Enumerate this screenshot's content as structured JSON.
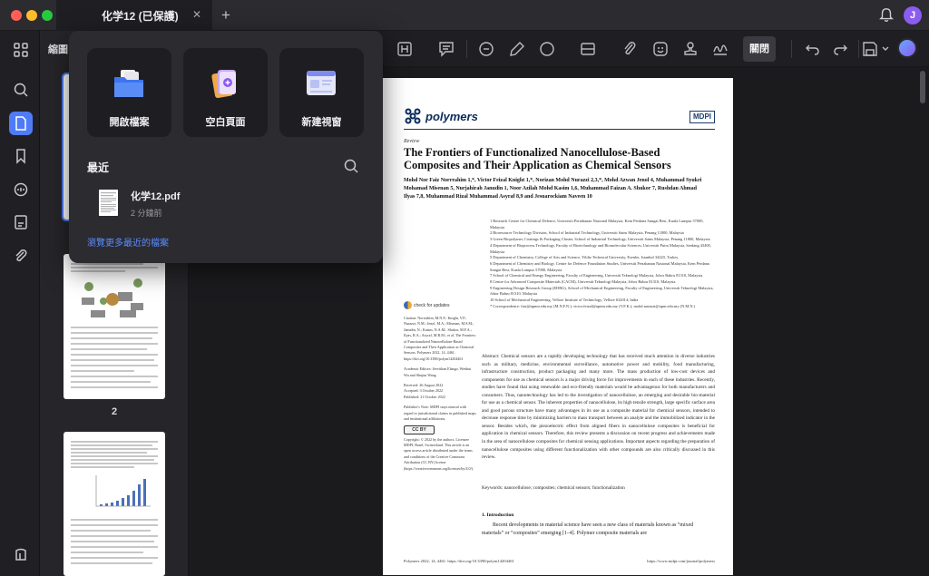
{
  "window": {
    "tab_title": "化学12 (已保護)",
    "tab_close": "✕",
    "tab_add": "+",
    "avatar_letter": "J"
  },
  "colors": {
    "accent": "#4f7bf7",
    "link": "#5b8cff",
    "avatar": "#8c5cf0",
    "close_dot": "#fe5f57",
    "min_dot": "#febc2e",
    "max_dot": "#28c840"
  },
  "sidebar": {
    "title": "縮圖",
    "rail_icons": [
      "grid-icon",
      "search-icon",
      "page-icon",
      "bookmark-icon",
      "comment-icon",
      "form-icon",
      "attachment-icon",
      "layers-icon"
    ],
    "pages": [
      "2"
    ]
  },
  "toolbar": {
    "close_mode_label": "關閉",
    "tools": [
      "textbox-icon",
      "note-icon",
      "comment-icon",
      "highlighter-icon",
      "shape-icon",
      "measure-icon",
      "attachment-icon",
      "sticker-icon",
      "stamp-icon",
      "signature-icon",
      "undo-icon",
      "redo-icon",
      "save-icon",
      "ai-assistant-icon"
    ]
  },
  "popup": {
    "actions": [
      {
        "label": "開啟檔案",
        "icon": "folder-icon"
      },
      {
        "label": "空白頁面",
        "icon": "blank-page-icon"
      },
      {
        "label": "新建視窗",
        "icon": "new-window-icon"
      }
    ],
    "recent_title": "最近",
    "recent_files": [
      {
        "name": "化学12.pdf",
        "time": "2 分鐘前"
      }
    ],
    "browse_more": "瀏覽更多最近的檔案"
  },
  "document": {
    "journal": "polymers",
    "publisher": "MDPI",
    "article_type": "Review",
    "title": "The Frontiers of Functionalized Nanocellulose-Based Composites and Their Application as Chemical Sensors",
    "authors": "Mohd Nor Faiz Norrrahim 1,*, Victor Feizal Knight 1,*, Norizan Mohd Nurazzi 2,3,*, Mohd Azwan Jenol 4, Muhammad Syukri Mohamad Misenan 5, Nurjahirah Janudin 1, Noor Azilah Mohd Kasim 1,6, Muhammad Faizan A. Shukor 7, Rushdan Ahmad Ilyas 7,8, Muhammad Rizal Muhammad Asyraf 8,9 and Jesuarockiam Naveen 10",
    "affiliations": [
      "1  Research Centre for Chemical Defence, Universiti Pertahanan Nasional Malaysia, Kem Perdana Sungai Besi, Kuala Lumpur 57000, Malaysia",
      "2  Bioresource Technology Division, School of Industrial Technology, Universiti Sains Malaysia, Penang 11800, Malaysia",
      "3  Green Biopolymer, Coatings & Packaging Cluster, School of Industrial Technology, Universiti Sains Malaysia, Penang 11800, Malaysia",
      "4  Department of Bioprocess Technology, Faculty of Biotechnology and Biomolecular Sciences, Universiti Putra Malaysia, Serdang 43400, Malaysia",
      "5  Department of Chemistry, College of Arts and Science, Yildiz Technical University, Esenler, Istanbul 34220, Turkey",
      "6  Department of Chemistry and Biology, Centre for Defence Foundation Studies, Universiti Pertahanan Nasional Malaysia, Kem Perdana Sungai Besi, Kuala Lumpur 57000, Malaysia",
      "7  School of Chemical and Energy Engineering, Faculty of Engineering, Universiti Teknologi Malaysia, Johor Bahru 81310, Malaysia",
      "8  Centre for Advanced Composite Materials (CACM), Universiti Teknologi Malaysia, Johor Bahru 81310, Malaysia",
      "9  Engineering Design Research Group (EDRG), School of Mechanical Engineering, Faculty of Engineering, Universiti Teknologi Malaysia, Johor Bahru 81310, Malaysia",
      "10 School of Mechanical Engineering, Vellore Institute of Technology, Vellore 632014, India",
      "*  Correspondence: faiz@upnm.edu.my (M.N.F.N.); victor.feizal@upnm.edu.my (V.F.K.); mohd.nurazzi@upm.edu.my (N.M.N.)"
    ],
    "check_updates": "check for updates",
    "citation": "Citation: Norrrahim, M.N.F.; Knight, V.F.; Nurazzi, N.M.; Jenol, M.A.; Misenan, M.S.M.; Janudin, N.; Kasim, N.A.M.; Shukor, M.F.A.; Ilyas, R.A.; Asyraf, M.R.M.; et al. The Frontiers of Functionalized Nanocellulose-Based Composites and Their Application as Chemical Sensors. Polymers 2022, 14, 4461. https://doi.org/10.3390/polym14204461",
    "editors": "Academic Editors: Jeevithan Elango, Wenhui Wu and Shujun Wang",
    "received": "Received: 26 August 2022",
    "accepted": "Accepted: 3 October 2022",
    "published": "Published: 21 October 2022",
    "publisher_note": "Publisher's Note: MDPI stays neutral with regard to jurisdictional claims in published maps and institutional affiliations.",
    "cc_badge": "CC BY",
    "copyright": "Copyright: © 2022 by the authors. Licensee MDPI, Basel, Switzerland. This article is an open access article distributed under the terms and conditions of the Creative Commons Attribution (CC BY) license (https://creativecommons.org/licenses/by/4.0/).",
    "abstract": "Abstract: Chemical sensors are a rapidly developing technology that has received much attention in diverse industries such as military, medicine, environmental surveillance, automotive power and mobility, food manufacturing, infrastructure construction, product packaging and many more. The mass production of low-cost devices and components for use as chemical sensors is a major driving force for improvements in each of these industries. Recently, studies have found that using renewable and eco-friendly materials would be advantageous for both manufacturers and consumers. Thus, nanotechnology has led to the investigation of nanocellulose, an emerging and desirable bio-material for use as a chemical sensor. The inherent properties of nanocellulose, its high tensile strength, large specific surface area and good porous structure have many advantages in its use as a composite material for chemical sensors, intended to decrease response time by minimizing barriers to mass transport between an analyte and the immobilized indicator in the sensor. Besides which, the piezoelectric effect from aligned fibers in nanocellulose composites is beneficial for application in chemical sensors. Therefore, this review presents a discussion on recent progress and achievements made in the area of nanocellulose composites for chemical sensing applications. Important aspects regarding the preparation of nanocellulose composites using different functionalization with other compounds are also critically discussed in this review.",
    "keywords": "Keywords: nanocellulose; composites; chemical sensors; functionalization",
    "intro_heading": "1. Introduction",
    "intro": "Recent developments in material science have seen a new class of materials known as “mixed materials” or “composites” emerging [1–4]. Polymer composite materials are",
    "footer_left": "Polymers 2022, 14, 4461. https://doi.org/10.3390/polym14204461",
    "footer_right": "https://www.mdpi.com/journal/polymers"
  }
}
